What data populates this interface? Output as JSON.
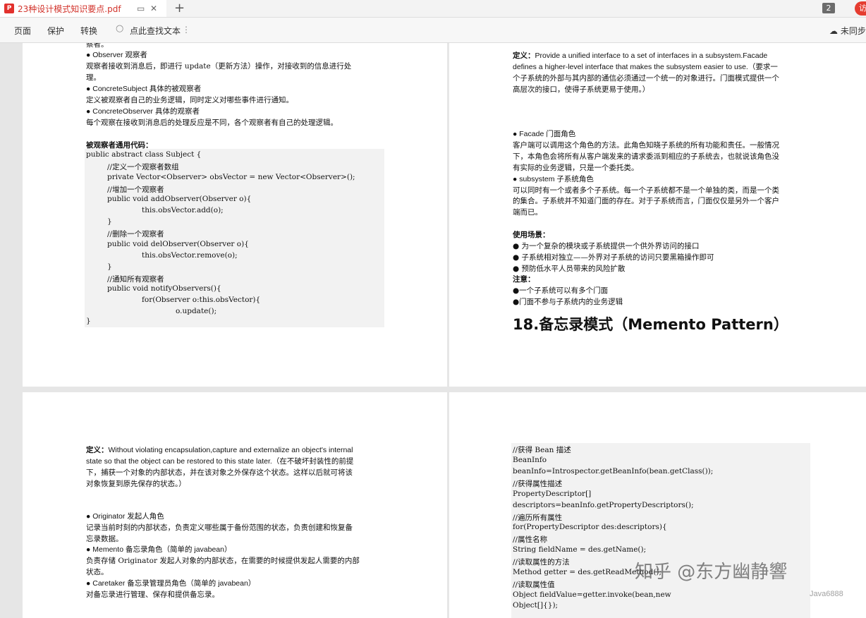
{
  "tab": {
    "title": "23种设计模式知识要点.pdf",
    "page_count": "2",
    "right_btn": "访"
  },
  "toolbar": {
    "page": "页面",
    "protect": "保护",
    "convert": "转换",
    "search": "点此查找文本",
    "sync": "未同步"
  },
  "p1": {
    "top_cut": "察者。",
    "lines": [
      "● Observer 观察者",
      "观察者接收到消息后，即进行 update（更新方法）操作，对接收到的信息进行处",
      "理。",
      "● ConcreteSubject 具体的被观察者",
      "定义被观察者自己的业务逻辑，同时定义对哪些事件进行通知。",
      "● ConcreteObserver 具体的观察者",
      "每个观察在接收到消息后的处理反应是不同，各个观察者有自己的处理逻辑。"
    ],
    "code_title": "被观察者通用代码：",
    "code": [
      "public abstract class Subject {",
      "        //定义一个观察者数组",
      "        private Vector<Observer> obsVector = new Vector<Observer>();",
      "        //增加一个观察者",
      "        public void addObserver(Observer o){",
      "                this.obsVector.add(o);",
      "        }",
      "        //删除一个观察者",
      "        public void delObserver(Observer o){",
      "                this.obsVector.remove(o);",
      "        }",
      "        //通知所有观察者",
      "        public void notifyObservers(){",
      "                for(Observer o:this.obsVector){",
      "                        o.update();",
      "}"
    ]
  },
  "p2": {
    "def_label": "定义：",
    "def_lines": [
      "Provide a unified interface to a set of interfaces in a subsystem.Facade",
      "defines a higher-level interface that makes the subsystem easier to use.（要求一",
      "个子系统的外部与其内部的通信必须通过一个统一的对象进行。门面模式提供一个",
      "高层次的接口，使得子系统更易于使用。）"
    ],
    "role_lines": [
      "● Facade 门面角色",
      "客户端可以调用这个角色的方法。此角色知晓子系统的所有功能和责任。一般情况",
      "下，本角色会将所有从客户端发来的请求委派到相应的子系统去，也就说该角色没",
      "有实际的业务逻辑，只是一个委托类。",
      "● subsystem 子系统角色",
      "可以同时有一个或者多个子系统。每一个子系统都不是一个单独的类，而是一个类",
      "的集合。子系统并不知道门面的存在。对于子系统而言，门面仅仅是另外一个客户",
      "端而已。"
    ],
    "usage_title": "使用场景：",
    "usage": [
      "● 为一个复杂的模块或子系统提供一个供外界访问的接口",
      "● 子系统相对独立——外界对子系统的访问只要黑箱操作即可",
      "● 预防低水平人员带来的风险扩散"
    ],
    "note_title": "注意：",
    "notes": [
      "●一个子系统可以有多个门面",
      "●门面不参与子系统内的业务逻辑"
    ],
    "heading": "18.备忘录模式（Memento Pattern）"
  },
  "p3": {
    "def_label": "定义：",
    "def_lines": [
      "Without violating encapsulation,capture and externalize an object's internal",
      "state so that the object can be restored to this state later.（在不破坏封装性的前提",
      "下，捕获一个对象的内部状态，并在该对象之外保存这个状态。这样以后就可将该",
      "对象恢复到原先保存的状态。）"
    ],
    "role_lines": [
      "● Originator 发起人角色",
      "记录当前时刻的内部状态，负责定义哪些属于备份范围的状态，负责创建和恢复备",
      "忘录数据。",
      "● Memento 备忘录角色（简单的 javabean）",
      "负责存储 Originator 发起人对象的内部状态，在需要的时候提供发起人需要的内部",
      "状态。",
      "● Caretaker 备忘录管理员角色（简单的 javabean）",
      "对备忘录进行管理、保存和提供备忘录。"
    ]
  },
  "p4": {
    "code": [
      "                //获得 Bean 描述",
      "                BeanInfo",
      "beanInfo=Introspector.getBeanInfo(bean.getClass());",
      "                //获得属性描述",
      "                PropertyDescriptor[]",
      "descriptors=beanInfo.getPropertyDescriptors();",
      "                //遍历所有属性",
      "                for(PropertyDescriptor des:descriptors){",
      "                        //属性名称",
      "                        String fieldName = des.getName();",
      "                        //读取属性的方法",
      "                        Method getter = des.getReadMethod();",
      "                        //读取属性值",
      "                        Object fieldValue=getter.invoke(bean,new",
      "Object[]{});"
    ]
  },
  "watermark": {
    "text": "知乎 @东方幽静響",
    "sub": "Java6888"
  }
}
